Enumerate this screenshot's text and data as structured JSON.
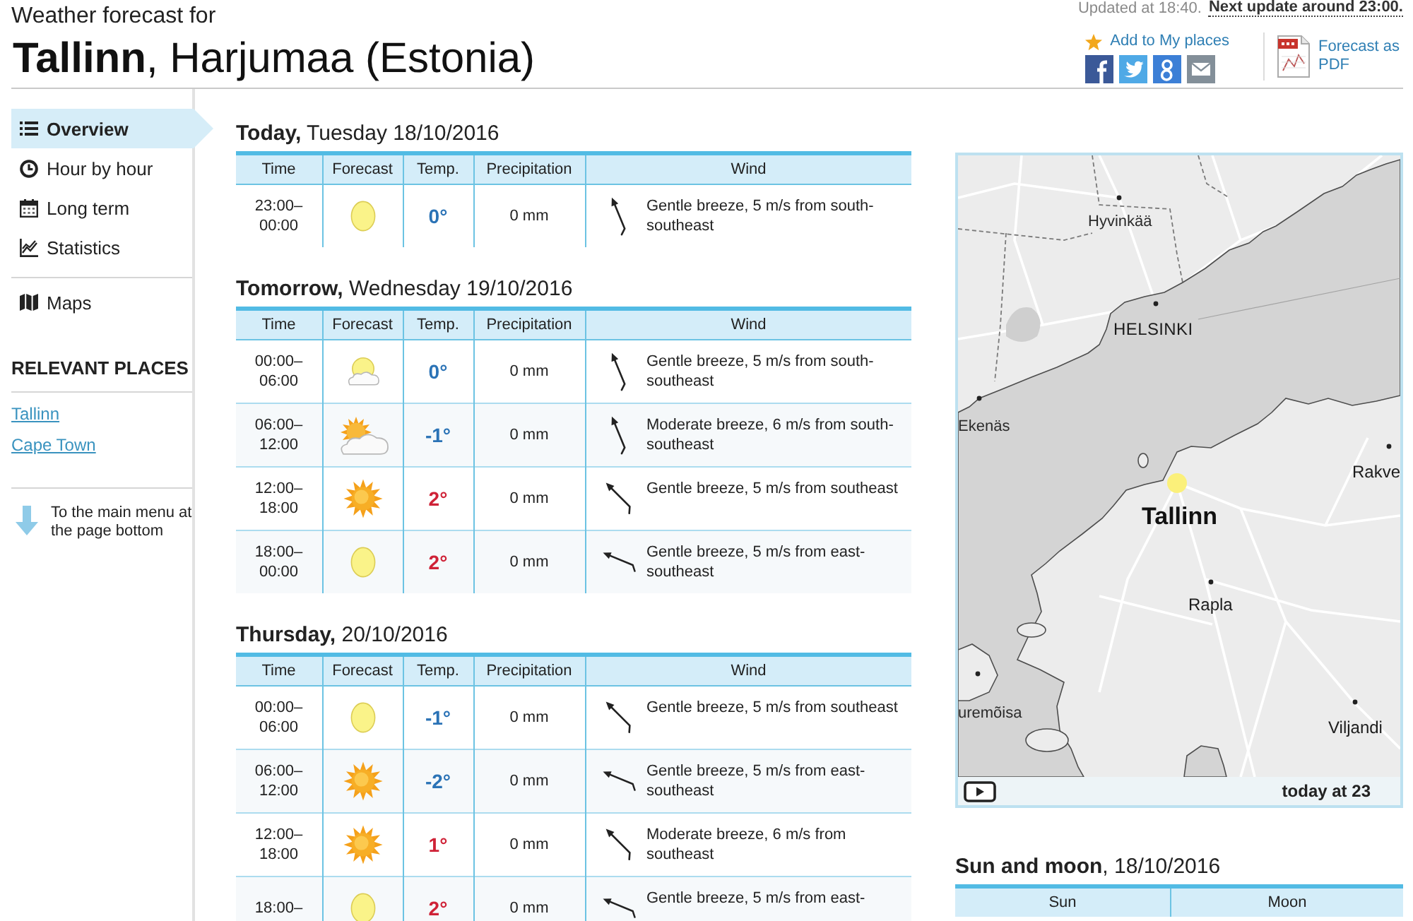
{
  "header": {
    "subtitle": "Weather forecast for",
    "title": "**Tallinn**, Harjumaa (Estonia)",
    "updated": "Updated at 18:40.",
    "next_update": "Next update around 23:00.",
    "add_place": "Add to My places",
    "pdf_link": "Forecast as PDF"
  },
  "sidebar": {
    "groups": [
      {
        "items": [
          {
            "label": "Overview",
            "kind": "list",
            "selected": true
          },
          {
            "label": "Hour by hour",
            "kind": "clock",
            "selected": false
          },
          {
            "label": "Long term",
            "kind": "calendar",
            "selected": false
          },
          {
            "label": "Statistics",
            "kind": "chart",
            "selected": false
          }
        ]
      },
      {
        "items": [
          {
            "label": "Maps",
            "kind": "map",
            "selected": false
          }
        ]
      }
    ],
    "places_heading": "RELEVANT PLACES",
    "places": [
      "Tallinn",
      "Cape Town"
    ],
    "menu_link": "To the main menu at the page bottom"
  },
  "days": [
    {
      "title": "**Today,** Tuesday 18/10/2016",
      "columns": [
        "Time",
        "Forecast",
        "Temp.",
        "Precipitation",
        "Wind"
      ],
      "rows": [
        {
          "time": "23:00–00:00",
          "forecast": {
            "kind": "moon"
          },
          "temp": "0°",
          "warm": false,
          "precipitation": "0 mm",
          "wind": {
            "kind": "sse",
            "text": "Gentle breeze, 5 m/s from south-southeast"
          }
        }
      ]
    },
    {
      "title": "**Tomorrow,** Wednesday 19/10/2016",
      "columns": [
        "Time",
        "Forecast",
        "Temp.",
        "Precipitation",
        "Wind"
      ],
      "rows": [
        {
          "time": "00:00–06:00",
          "forecast": {
            "kind": "cloudmoon"
          },
          "temp": "0°",
          "warm": false,
          "precipitation": "0 mm",
          "wind": {
            "kind": "sse",
            "text": "Gentle breeze, 5 m/s from south-southeast"
          }
        },
        {
          "time": "06:00–12:00",
          "forecast": {
            "kind": "cloudsun"
          },
          "temp": "-1°",
          "warm": false,
          "precipitation": "0 mm",
          "wind": {
            "kind": "sse",
            "text": "Moderate breeze, 6 m/s from south-southeast"
          }
        },
        {
          "time": "12:00–18:00",
          "forecast": {
            "kind": "sun"
          },
          "temp": "2°",
          "warm": true,
          "precipitation": "0 mm",
          "wind": {
            "kind": "se",
            "text": "Gentle breeze, 5 m/s from southeast"
          }
        },
        {
          "time": "18:00–00:00",
          "forecast": {
            "kind": "moon"
          },
          "temp": "2°",
          "warm": true,
          "precipitation": "0 mm",
          "wind": {
            "kind": "ese",
            "text": "Gentle breeze, 5 m/s from east-southeast"
          }
        }
      ]
    },
    {
      "title": "**Thursday,** 20/10/2016",
      "columns": [
        "Time",
        "Forecast",
        "Temp.",
        "Precipitation",
        "Wind"
      ],
      "rows": [
        {
          "time": "00:00–06:00",
          "forecast": {
            "kind": "moon"
          },
          "temp": "-1°",
          "warm": false,
          "precipitation": "0 mm",
          "wind": {
            "kind": "se",
            "text": "Gentle breeze, 5 m/s from southeast"
          }
        },
        {
          "time": "06:00–12:00",
          "forecast": {
            "kind": "sun"
          },
          "temp": "-2°",
          "warm": false,
          "precipitation": "0 mm",
          "wind": {
            "kind": "ese",
            "text": "Gentle breeze, 5 m/s from east-southeast"
          }
        },
        {
          "time": "12:00–18:00",
          "forecast": {
            "kind": "sun"
          },
          "temp": "1°",
          "warm": true,
          "precipitation": "0 mm",
          "wind": {
            "kind": "se",
            "text": "Moderate breeze, 6 m/s from southeast"
          }
        },
        {
          "time": "18:00–",
          "forecast": {
            "kind": "moon"
          },
          "temp": "2°",
          "warm": true,
          "precipitation": "0 mm",
          "wind": {
            "kind": "ese",
            "text": "Gentle breeze, 5 m/s from east-"
          }
        }
      ]
    }
  ],
  "map": {
    "labels": [
      {
        "text": "Hyvinkää",
        "kind": "minor"
      },
      {
        "text": "HELSINKI",
        "kind": "capital"
      },
      {
        "text": "Ekenäs",
        "kind": "minor"
      },
      {
        "text": "Rakve",
        "kind": "town"
      },
      {
        "text": "Tallinn",
        "kind": "focus"
      },
      {
        "text": "Rapla",
        "kind": "town"
      },
      {
        "text": "uremõisa",
        "kind": "minor"
      },
      {
        "text": "Viljandi",
        "kind": "town"
      }
    ],
    "time_label": "today at 23"
  },
  "sun_moon": {
    "title": "**Sun and moon**, 18/10/2016",
    "columns": [
      "Sun",
      "Moon"
    ]
  }
}
